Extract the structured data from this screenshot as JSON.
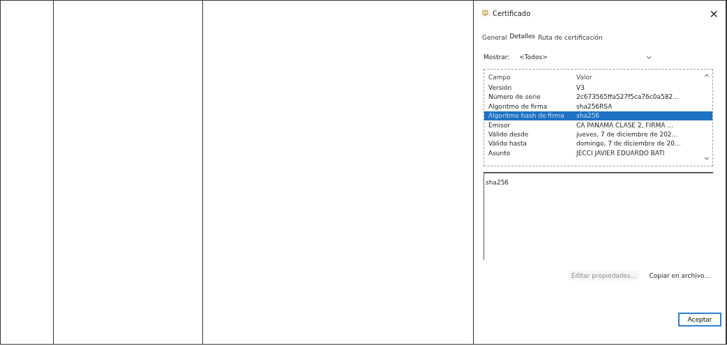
{
  "dialog": {
    "title": "Certificado",
    "close": "×",
    "tabs": [
      {
        "label": "General",
        "selected": false
      },
      {
        "label": "Detalles",
        "selected": true
      },
      {
        "label": "Ruta de certificación",
        "selected": false
      }
    ],
    "show": {
      "label": "Mostrar:",
      "value": "<Todos>"
    },
    "columns": [
      "Campo",
      "Valor"
    ],
    "fields": [
      {
        "field": "Versión",
        "value": "V3",
        "selected": false
      },
      {
        "field": "Número de serie",
        "value": "2c673565ffa527f5ca76c0a582...",
        "selected": false
      },
      {
        "field": "Algoritmo de firma",
        "value": "sha256RSA",
        "selected": false
      },
      {
        "field": "Algoritmo hash de firma",
        "value": "sha256",
        "selected": true
      },
      {
        "field": "Emisor",
        "value": "CA PANAMA CLASE 2, FIRMA ...",
        "selected": false
      },
      {
        "field": "Válido desde",
        "value": "jueves, 7 de diciembre de 202...",
        "selected": false
      },
      {
        "field": "Válido hasta",
        "value": "domingo, 7 de diciembre de 20...",
        "selected": false
      },
      {
        "field": "Asunto",
        "value": "JECCI JAVIER EDUARDO BATI",
        "selected": false
      }
    ],
    "detail": "sha256",
    "buttons": [
      {
        "label": "Editar propiedades...",
        "disabled": true
      },
      {
        "label": "Copiar en archivo...",
        "disabled": false
      }
    ],
    "ok": "Aceptar"
  }
}
